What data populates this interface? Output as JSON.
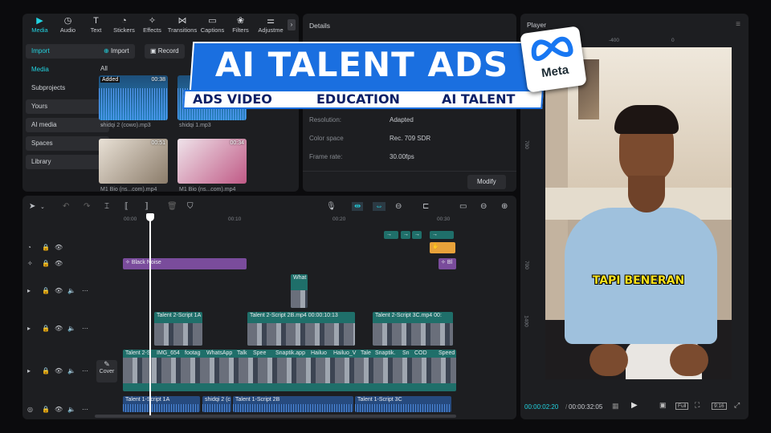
{
  "toolbar": {
    "items": [
      {
        "label": "Media",
        "icon": "media-icon"
      },
      {
        "label": "Audio",
        "icon": "audio-icon"
      },
      {
        "label": "Text",
        "icon": "text-icon"
      },
      {
        "label": "Stickers",
        "icon": "stickers-icon"
      },
      {
        "label": "Effects",
        "icon": "effects-icon"
      },
      {
        "label": "Transitions",
        "icon": "transitions-icon"
      },
      {
        "label": "Captions",
        "icon": "captions-icon"
      },
      {
        "label": "Filters",
        "icon": "filters-icon"
      },
      {
        "label": "Adjustme",
        "icon": "adjustment-icon"
      }
    ],
    "active": "Media"
  },
  "sidebar": {
    "import": "Import",
    "media": "Media",
    "subprojects": "Subprojects",
    "yours": "Yours",
    "ai_media": "AI media",
    "spaces": "Spaces",
    "library": "Library"
  },
  "media": {
    "import_button": "Import",
    "record_button": "Record",
    "filter_all": "All",
    "items": [
      {
        "name": "shidqi 2 (cowo).mp3",
        "duration": "00:38",
        "badge": "Added"
      },
      {
        "name": "shidqi 1.mp3",
        "duration": ""
      },
      {
        "name": "M1 Bio (ns...com).mp4",
        "duration": "00:51"
      },
      {
        "name": "M1 Bio (ns...com).mp4",
        "duration": "00:34"
      }
    ]
  },
  "details": {
    "title": "Details",
    "rows": [
      {
        "label": "Resolution:",
        "value": "Adapted"
      },
      {
        "label": "Color space",
        "value": "Rec. 709 SDR"
      },
      {
        "label": "Frame rate:",
        "value": "30.00fps"
      }
    ],
    "modify_button": "Modify"
  },
  "player": {
    "title": "Player",
    "ruler_top": [
      "-400",
      "0"
    ],
    "ruler_left": [
      "700",
      "700",
      "1400"
    ],
    "caption": "TAPI BENERAN",
    "current_time": "00:00:02:20",
    "total_time": "00:00:32:05",
    "full_label": "Full",
    "ratio_label": "9:16"
  },
  "banner": {
    "title": "AI TALENT ADS",
    "tags": [
      "ADS VIDEO",
      "EDUCATION",
      "AI TALENT"
    ],
    "meta_name": "Meta"
  },
  "timeline": {
    "ruler": [
      "00:00",
      "00:10",
      "00:20",
      "00:30"
    ],
    "cover_label": "Cover",
    "clips": {
      "effect": "Black Noise",
      "effect2": "Bl",
      "overlay": "What",
      "talent_a": "Talent 2-Script 1A",
      "talent_b": "Talent 2-Script 2B.mp4",
      "talent_b_time": "00:00:10:13",
      "talent_c": "Talent 2-Script 3C.mp4",
      "talent_c_time": "00:",
      "main_labels": [
        "Talent 2-S",
        "IMG_654",
        "footag",
        "WhatsApp",
        "Talk",
        "Spee",
        "Snaptik.app",
        "Hailuo",
        "Hailuo_V",
        "Tale",
        "Snaptik.",
        "Sn",
        "COD",
        "Speed"
      ],
      "audio_a": "Talent 1-Script 1A",
      "audio_b": "shidqi 2 (c",
      "audio_c": "Talent 1-Script 2B",
      "audio_d": "Talent 1-Script 3C"
    }
  },
  "colors": {
    "accent": "#22d3e0",
    "banner_blue": "#1a6fe0",
    "clip_teal": "#1f6f6a",
    "clip_purple": "#7a4c9c",
    "clip_orange": "#e8a23a",
    "audio_blue": "#264a7e"
  }
}
